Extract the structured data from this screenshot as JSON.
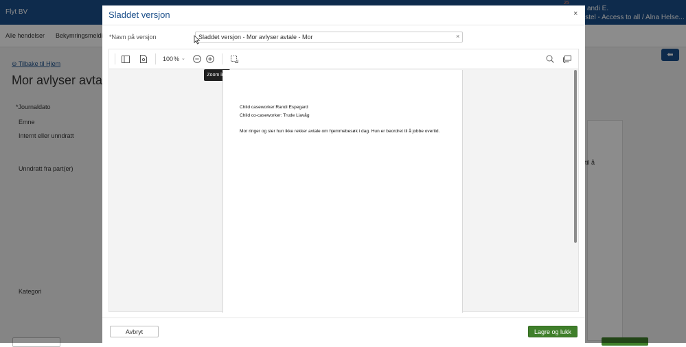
{
  "background": {
    "app_name": "Flyt BV",
    "user_name": "andi E.",
    "user_role": "istel - Access to all / Alna Helse...",
    "notification": "25",
    "nav": [
      "Alle hendelser",
      "Bekymringsmeldi"
    ],
    "back_link": "Tilbake til Hjem",
    "page_title": "Mor avlyser avtale",
    "fields": {
      "journaldato": "*Journaldato",
      "emne": "Emne",
      "internt": "Internt eller unndratt",
      "unndratt": "Unndratt fra part(er)",
      "kategori": "Kategori"
    },
    "right_text": "til å",
    "side_tab_icon": "arrow-left-icon"
  },
  "modal": {
    "title": "Sladdet versjon",
    "close_symbol": "×",
    "name_label": "*Navn på versjon",
    "name_value": "Sladdet versjon - Mor avlyser avtale - Mor",
    "clear_symbol": "×",
    "toolbar": {
      "zoom_value": "100",
      "zoom_unit": "%",
      "icons": [
        "sidebar-toggle-icon",
        "document-icon",
        "zoom-out-icon",
        "zoom-in-icon",
        "select-area-icon",
        "search-icon",
        "comments-icon"
      ]
    },
    "tooltip": "Zoom inn",
    "document": {
      "lines": [
        "Child caseworker:Randi Espegard",
        "Child co-caseworker: Trude Liavåg",
        "Mor ringer og sier hun ikke rekker avtale om hjemmebesøk i dag. Hun er beordret til å jobbe overtid."
      ]
    },
    "cancel_label": "Avbryt",
    "save_label": "Lagre og lukk"
  },
  "colors": {
    "brand": "#1b4f8a",
    "primary_button": "#3f7f2a",
    "tooltip_bg": "#1f1f1f"
  }
}
